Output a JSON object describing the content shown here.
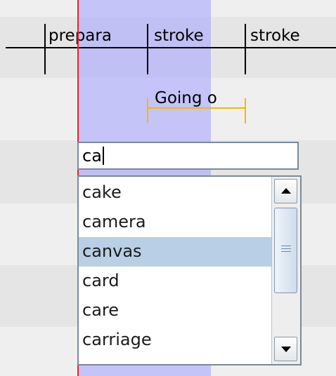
{
  "tier": {
    "labels": [
      "prepara",
      "stroke",
      "stroke"
    ]
  },
  "reference": {
    "label": "Going o"
  },
  "editor": {
    "value": "ca"
  },
  "suggestions": {
    "items": [
      "cake",
      "camera",
      "canvas",
      "card",
      "care",
      "carriage"
    ],
    "selected": "canvas"
  },
  "colors": {
    "selection": "#aaaaff",
    "playhead": "#ff1a1a",
    "reference_marker": "#f5b800",
    "list_highlight": "#b8cfe5"
  },
  "icons": {
    "scroll_up": "triangle-up-icon",
    "scroll_down": "triangle-down-icon",
    "thumb": "grip-lines-icon"
  }
}
